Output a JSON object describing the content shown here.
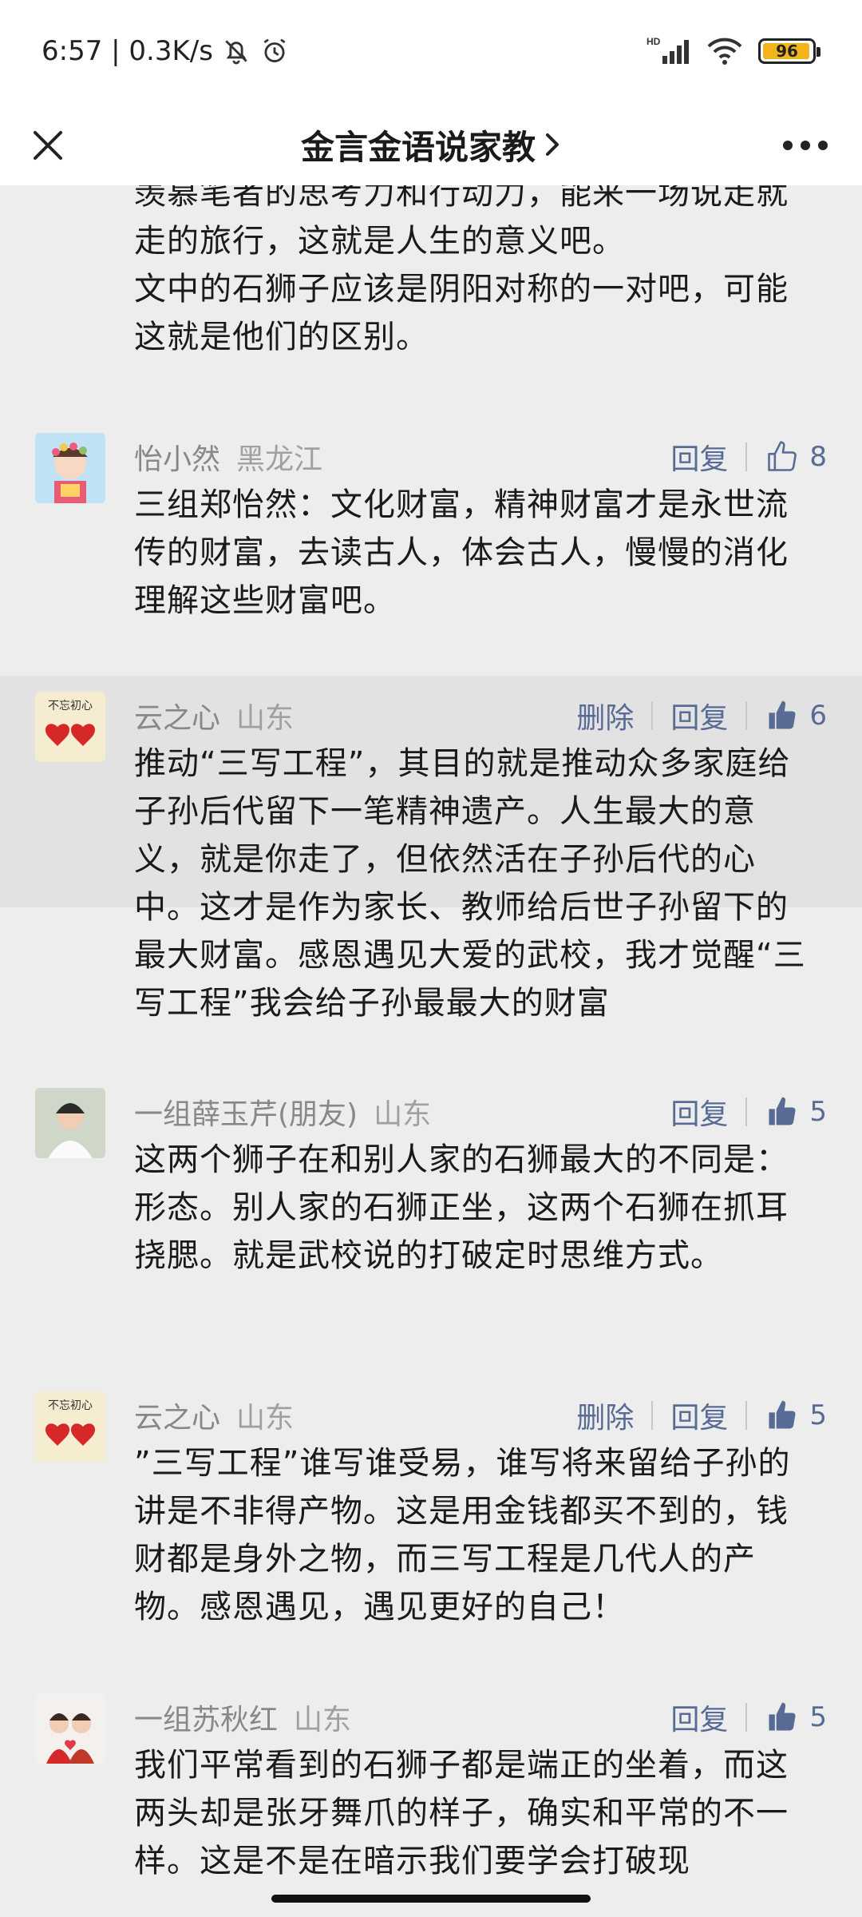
{
  "status_bar": {
    "time_speed": "6:57 | 0.3K/s",
    "hd_label": "HD",
    "battery": "96",
    "battery_level": 0.96
  },
  "header": {
    "title": "金言金语说家教",
    "title_chevron": "›"
  },
  "icons": {
    "close": "close-icon",
    "more": "more-icon",
    "like_outline": "thumbs-up-outline-icon",
    "like_filled": "thumbs-up-filled-icon",
    "mute": "mute-bell-icon",
    "alarm": "alarm-clock-icon",
    "signal": "signal-icon",
    "wifi": "wifi-icon"
  },
  "colors": {
    "link": "#576b95",
    "background": "#ededed",
    "highlight": "#e2e2e2"
  },
  "partial_comment": {
    "text": "羡慕笔者的思考力和行动力，能来一场说走就走的旅行，这就是人生的意义吧。\n文中的石狮子应该是阴阳对称的一对吧，可能这就是他们的区别。"
  },
  "comments": [
    {
      "name": "怡小然",
      "location": "黑龙江",
      "delete": "",
      "reply": "回复",
      "likes": "8",
      "liked": false,
      "text": "三组郑怡然：文化财富，精神财富才是永世流传的财富，去读古人，体会古人，慢慢的消化理解这些财富吧。"
    },
    {
      "name": "云之心",
      "location": "山东",
      "delete": "删除",
      "reply": "回复",
      "likes": "6",
      "liked": true,
      "text": "推动“三写工程”，其目的就是推动众多家庭给子孙后代留下一笔精神遗产。人生最大的意义，就是你走了，但依然活在子孙后代的心中。这才是作为家长、教师给后世子孙留下的最大财富。感恩遇见大爱的武校，我才觉醒“三写工程”我会给子孙最最大的财富"
    },
    {
      "name": "一组薛玉芹(朋友)",
      "location": "山东",
      "delete": "",
      "reply": "回复",
      "likes": "5",
      "liked": true,
      "text": "这两个狮子在和别人家的石狮最大的不同是：形态。别人家的石狮正坐，这两个石狮在抓耳挠腮。就是武校说的打破定时思维方式。"
    },
    {
      "name": "云之心",
      "location": "山东",
      "delete": "删除",
      "reply": "回复",
      "likes": "5",
      "liked": true,
      "text": "”三写工程”谁写谁受易，谁写将来留给子孙的讲是不非得产物。这是用金钱都买不到的，钱财都是身外之物，而三写工程是几代人的产物。感恩遇见，遇见更好的自己！"
    },
    {
      "name": "一组苏秋红",
      "location": "山东",
      "delete": "",
      "reply": "回复",
      "likes": "5",
      "liked": true,
      "text": "我们平常看到的石狮子都是端正的坐着，而这两头却是张牙舞爪的样子，确实和平常的不一样。这是不是在暗示我们要学会打破现"
    }
  ]
}
